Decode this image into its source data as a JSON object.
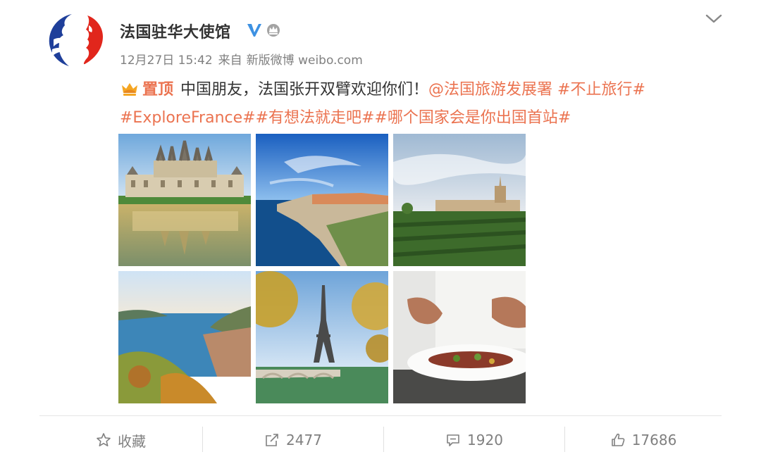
{
  "post": {
    "author": "法国驻华大使馆",
    "time": "12月27日 15:42",
    "source_prefix": "来自",
    "source": "新版微博 weibo.com",
    "pin_label": "置顶",
    "text_main": "中国朋友，法国张开双臂欢迎你们！",
    "mention": "@法国旅游发展署",
    "topics": [
      "#不止旅行#",
      "#ExploreFrance#",
      "#有想法就走吧#",
      "#哪个国家会是你出国首站#"
    ]
  },
  "photos": [
    {
      "name": "chateau-photo"
    },
    {
      "name": "coastal-cliff-photo"
    },
    {
      "name": "vineyard-photo"
    },
    {
      "name": "riviera-bay-photo"
    },
    {
      "name": "eiffel-tower-photo"
    },
    {
      "name": "chef-plating-photo"
    }
  ],
  "actions": {
    "favorite": "收藏",
    "repost": "2477",
    "comment": "1920",
    "like": "17686"
  },
  "colors": {
    "accent": "#eb7350",
    "verified": "#3d91e2",
    "text": "#333333",
    "muted": "#808080"
  },
  "icons": [
    "avatar-logo",
    "verified-icon",
    "crown-badge-icon",
    "chevron-down-icon",
    "pin-crown-icon",
    "star-icon",
    "share-icon",
    "comment-icon",
    "thumbs-up-icon"
  ]
}
